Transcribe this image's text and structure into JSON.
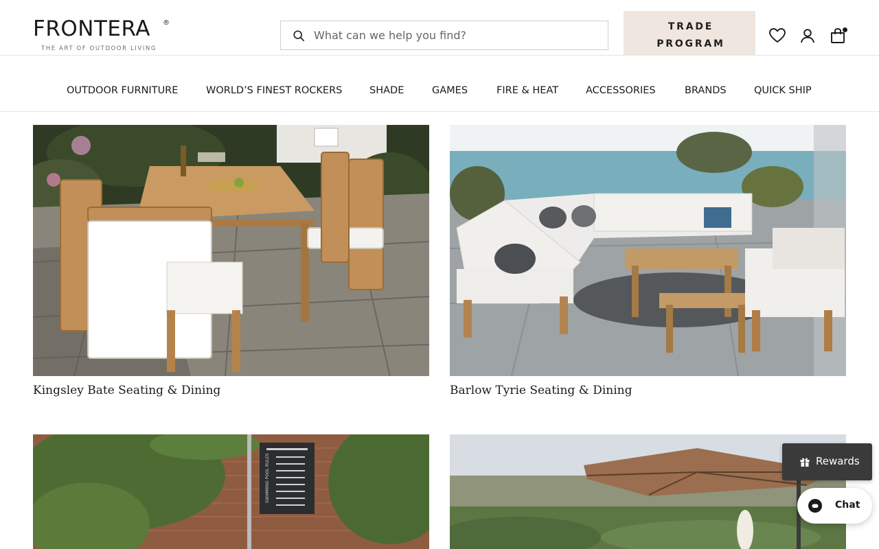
{
  "header": {
    "logo_text": "FRONTERA",
    "logo_reg": "®",
    "logo_tagline": "THE ART OF OUTDOOR LIVING",
    "search_placeholder": "What can we help you find?",
    "trade_label": "TRADE\nPROGRAM",
    "icons": [
      "search-icon",
      "heart-icon",
      "account-icon",
      "cart-icon"
    ],
    "cart_has_items": true
  },
  "nav": {
    "items": [
      {
        "label": "OUTDOOR FURNITURE"
      },
      {
        "label": "WORLD’S FINEST ROCKERS"
      },
      {
        "label": "SHADE"
      },
      {
        "label": "GAMES"
      },
      {
        "label": "FIRE & HEAT"
      },
      {
        "label": "ACCESSORIES"
      },
      {
        "label": "BRANDS"
      },
      {
        "label": "QUICK SHIP"
      }
    ]
  },
  "collections": [
    {
      "title": "Kingsley Bate Seating & Dining"
    },
    {
      "title": "Barlow Tyrie Seating & Dining"
    },
    {
      "title": ""
    },
    {
      "title": ""
    }
  ],
  "sign_text": "SWIMMING POOL RULES",
  "widgets": {
    "rewards_label": "Rewards",
    "chat_label": "Chat"
  },
  "colors": {
    "trade_bg": "#efe6df",
    "rewards_bg": "#3a3a3a",
    "text": "#1a1a1a"
  }
}
